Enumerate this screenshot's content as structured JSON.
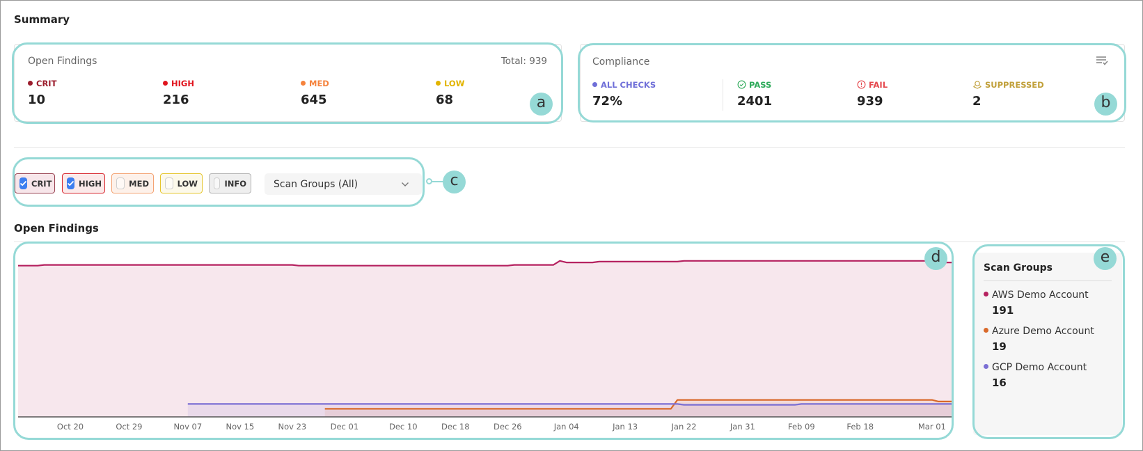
{
  "summary": {
    "title": "Summary",
    "open_findings": {
      "title": "Open Findings",
      "total": "Total: 939",
      "stats": [
        {
          "label": "CRIT",
          "value": "10",
          "color": "#9b1c2c"
        },
        {
          "label": "HIGH",
          "value": "216",
          "color": "#e0141e"
        },
        {
          "label": "MED",
          "value": "645",
          "color": "#f5823c"
        },
        {
          "label": "LOW",
          "value": "68",
          "color": "#e2b400"
        }
      ]
    },
    "compliance": {
      "title": "Compliance",
      "menu_icon": "list-check-icon",
      "stats": [
        {
          "label": "ALL CHECKS",
          "value": "72%",
          "color": "#6f6fd8",
          "icon": "dot"
        },
        {
          "label": "PASS",
          "value": "2401",
          "color": "#2eaa5a",
          "icon": "check-circle-icon"
        },
        {
          "label": "FAIL",
          "value": "939",
          "color": "#e5484d",
          "icon": "alert-circle-icon"
        },
        {
          "label": "SUPPRESSED",
          "value": "2",
          "color": "#c1a03a",
          "icon": "suppressed-icon"
        }
      ]
    }
  },
  "filters": {
    "chips": [
      {
        "label": "CRIT",
        "checked": true
      },
      {
        "label": "HIGH",
        "checked": true
      },
      {
        "label": "MED",
        "checked": false
      },
      {
        "label": "LOW",
        "checked": false
      },
      {
        "label": "INFO",
        "checked": false
      }
    ],
    "scan_groups_select": "Scan Groups (All)"
  },
  "annotations": [
    "a",
    "b",
    "c",
    "d",
    "e"
  ],
  "open_findings_chart": {
    "title": "Open Findings"
  },
  "chart_data": {
    "type": "area",
    "title": "Open Findings",
    "xlabel": "",
    "ylabel": "",
    "x_ticks": [
      "Oct 20",
      "Oct 29",
      "Nov 07",
      "Nov 15",
      "Nov 23",
      "Dec 01",
      "Dec 10",
      "Dec 18",
      "Dec 26",
      "Jan 04",
      "Jan 13",
      "Jan 22",
      "Jan 31",
      "Feb 09",
      "Feb 18",
      "Mar 01"
    ],
    "x_range": [
      "Oct 12",
      "Mar 04"
    ],
    "ylim": [
      0,
      210
    ],
    "grid": false,
    "legend": "right-panel",
    "series": [
      {
        "name": "AWS Demo Account",
        "color": "#b5215f",
        "points": [
          [
            "Oct 12",
            187
          ],
          [
            "Oct 15",
            187
          ],
          [
            "Oct 16",
            188
          ],
          [
            "Nov 23",
            188
          ],
          [
            "Nov 24",
            187
          ],
          [
            "Dec 26",
            187
          ],
          [
            "Dec 27",
            188
          ],
          [
            "Jan 02",
            188
          ],
          [
            "Jan 03",
            193
          ],
          [
            "Jan 04",
            191
          ],
          [
            "Jan 08",
            191
          ],
          [
            "Jan 09",
            192
          ],
          [
            "Jan 21",
            192
          ],
          [
            "Jan 22",
            193
          ],
          [
            "Mar 01",
            193
          ],
          [
            "Mar 02",
            190
          ],
          [
            "Mar 03",
            191
          ],
          [
            "Mar 04",
            191
          ]
        ]
      },
      {
        "name": "Azure Demo Account",
        "color": "#d9692a",
        "points": [
          [
            "Nov 28",
            10
          ],
          [
            "Jan 20",
            10
          ],
          [
            "Jan 21",
            21
          ],
          [
            "Mar 01",
            21
          ],
          [
            "Mar 02",
            19
          ],
          [
            "Mar 04",
            19
          ]
        ]
      },
      {
        "name": "GCP Demo Account",
        "color": "#7b6fd4",
        "points": [
          [
            "Nov 07",
            16
          ],
          [
            "Jan 21",
            16
          ],
          [
            "Jan 22",
            15
          ],
          [
            "Feb 08",
            15
          ],
          [
            "Feb 09",
            16
          ],
          [
            "Mar 04",
            16
          ]
        ]
      }
    ]
  },
  "scan_groups_legend": {
    "title": "Scan Groups",
    "items": [
      {
        "name": "AWS Demo Account",
        "value": "191",
        "color": "#b5215f"
      },
      {
        "name": "Azure Demo Account",
        "value": "19",
        "color": "#d9692a"
      },
      {
        "name": "GCP Demo Account",
        "value": "16",
        "color": "#7b6fd4"
      }
    ]
  }
}
